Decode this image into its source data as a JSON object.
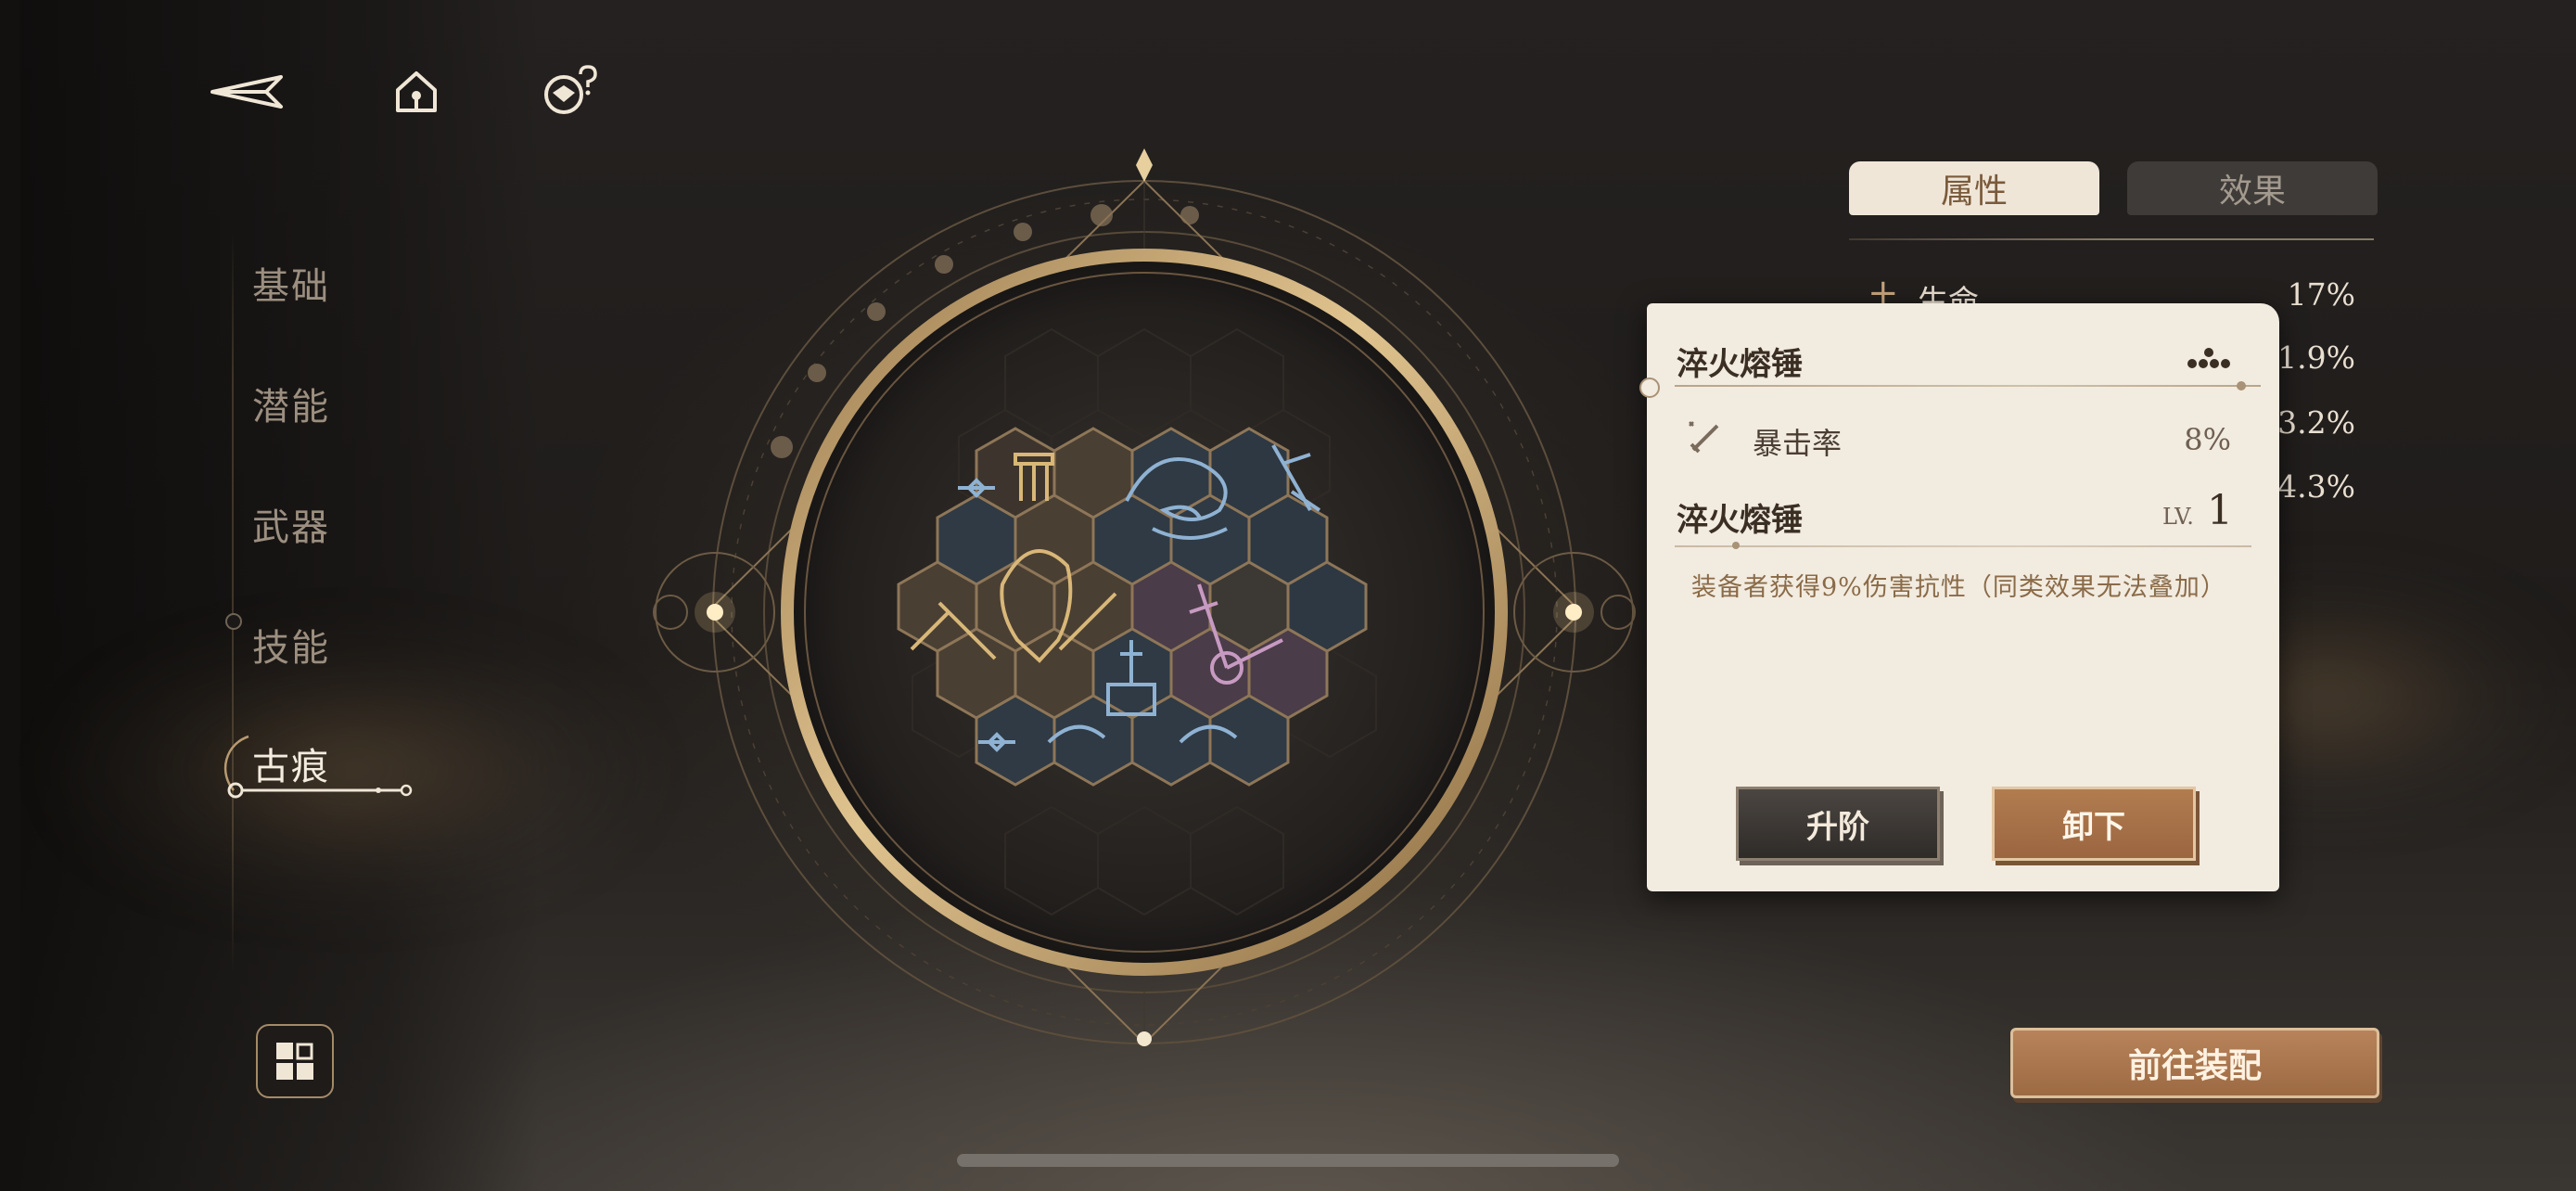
{
  "nav": {
    "items": [
      {
        "label": "基础"
      },
      {
        "label": "潜能"
      },
      {
        "label": "武器"
      },
      {
        "label": "技能"
      },
      {
        "label": "古痕",
        "active": true
      }
    ]
  },
  "top_icons": [
    "back-arrow-icon",
    "home-icon",
    "help-bubble-icon"
  ],
  "tabs": {
    "attributes": "属性",
    "effects": "效果",
    "active": "attributes"
  },
  "stats": [
    {
      "name": "生命",
      "value": "17%"
    },
    {
      "name": "",
      "value": "1.9%"
    },
    {
      "name": "",
      "value": "3.2%"
    },
    {
      "name": "",
      "value": "4.3%"
    }
  ],
  "card": {
    "title": "淬火熔锤",
    "stat_label": "暴击率",
    "stat_value": "8%",
    "subtitle": "淬火熔锤",
    "level_prefix": "LV.",
    "level": "1",
    "description": "装备者获得9%伤害抗性（同类效果无法叠加）",
    "upgrade_button": "升阶",
    "unequip_button": "卸下"
  },
  "goto_button": "前往装配",
  "colors": {
    "accent_gold": "#c9a36d",
    "card_bg": "#f2ebe0",
    "button_copper": "#a86f45",
    "background": "#1f1c1a"
  }
}
